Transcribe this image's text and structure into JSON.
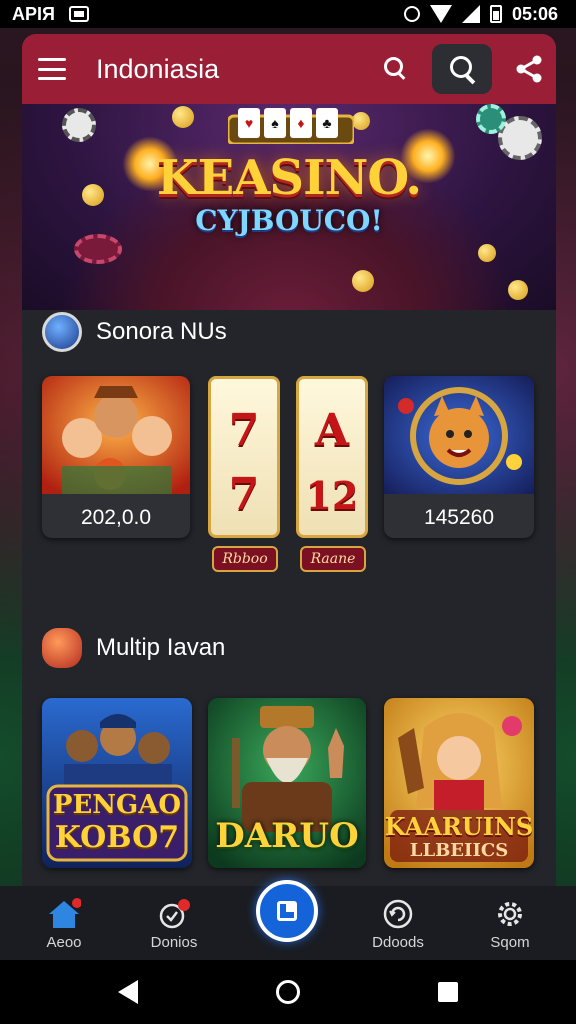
{
  "status_bar": {
    "left_text": "APIЯ",
    "time": "05:06"
  },
  "header": {
    "title": "Indoniasia"
  },
  "hero": {
    "title": "KEASINO.",
    "subtitle": "CYJBOUCO!"
  },
  "section1": {
    "title": "Sonora NUs",
    "tiles": [
      {
        "value": "202,0.0"
      },
      {
        "value": "145260"
      }
    ],
    "reels": [
      {
        "symbols": [
          "7",
          "7"
        ],
        "tag": "Rbboo"
      },
      {
        "symbols": [
          "A",
          "12"
        ],
        "tag": "Raane"
      }
    ]
  },
  "section2": {
    "title": "Multip Iavan",
    "tiles": [
      {
        "caption_top": "PENGAO",
        "caption_bottom": "KOBO7"
      },
      {
        "caption_top": "DARUO",
        "caption_bottom": ""
      },
      {
        "caption_top": "KAARUINS",
        "caption_bottom": "LLBEIICS"
      }
    ]
  },
  "bottom_nav": {
    "items": [
      {
        "label": "Aeoo",
        "icon": "home-icon"
      },
      {
        "label": "Donios",
        "icon": "chat-notification-icon"
      },
      {
        "label": "Ddoods",
        "icon": "refresh-icon"
      },
      {
        "label": "Sqom",
        "icon": "settings-icon"
      }
    ],
    "fab_icon": "center-action-icon"
  },
  "colors": {
    "header": "#9a1f36",
    "panel": "#23252a",
    "nav_bar": "#1a1c21",
    "accent_blue": "#1463d9",
    "home_blue": "#2e86e0"
  }
}
